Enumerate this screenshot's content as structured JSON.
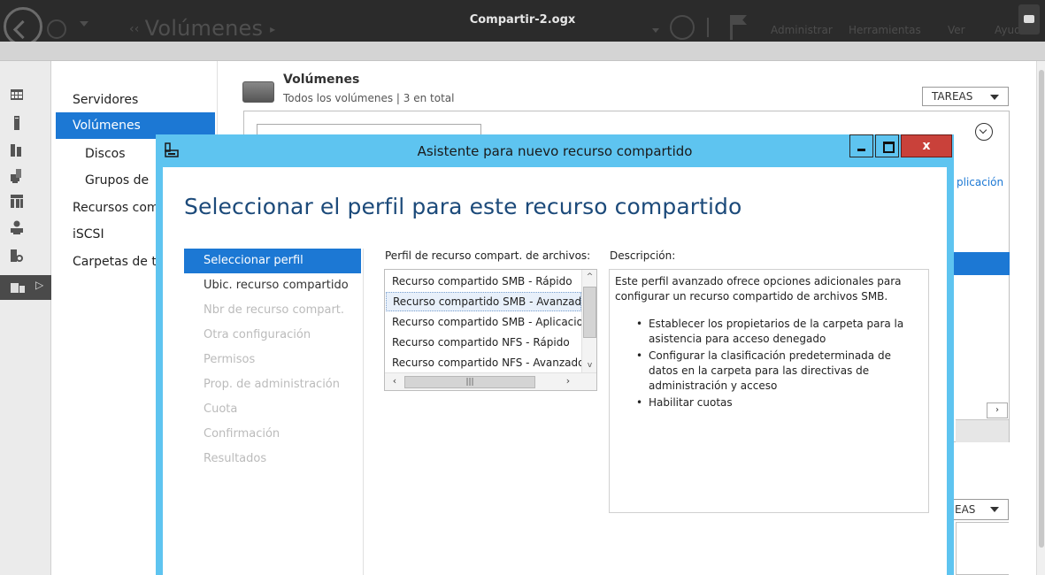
{
  "topbar": {
    "breadcrumb": "Volúmenes",
    "document_title": "Compartir-2.ogx",
    "menu": [
      "Administrar",
      "Herramientas",
      "Ver",
      "Ayuda"
    ]
  },
  "nav": {
    "items": [
      {
        "label": "Servidores"
      },
      {
        "label": "Volúmenes"
      },
      {
        "label": "Discos"
      },
      {
        "label": "Grupos de"
      },
      {
        "label": "Recursos com"
      },
      {
        "label": "iSCSI"
      },
      {
        "label": "Carpetas de t"
      }
    ]
  },
  "volumes": {
    "title": "Volúmenes",
    "subtitle": "Todos los volúmenes | 3 en total",
    "tasks_label": "TAREAS",
    "column_link": "plicación",
    "tasks_label_2": "EAS"
  },
  "wizard": {
    "window_title": "Asistente para nuevo recurso compartido",
    "heading": "Seleccionar el perfil para este recurso compartido",
    "steps": [
      {
        "label": "Seleccionar perfil"
      },
      {
        "label": "Ubic. recurso compartido"
      },
      {
        "label": "Nbr de recurso compart."
      },
      {
        "label": "Otra configuración"
      },
      {
        "label": "Permisos"
      },
      {
        "label": "Prop. de administración"
      },
      {
        "label": "Cuota"
      },
      {
        "label": "Confirmación"
      },
      {
        "label": "Resultados"
      }
    ],
    "profile_label": "Perfil de recurso compart. de archivos:",
    "profiles": [
      "Recurso compartido SMB - Rápido",
      "Recurso compartido SMB - Avanzado",
      "Recurso compartido SMB - Aplicaciones",
      "Recurso compartido NFS - Rápido",
      "Recurso compartido NFS - Avanzado"
    ],
    "selected_profile_index": 1,
    "description_label": "Descripción:",
    "description_intro": "Este perfil avanzado ofrece opciones adicionales para configurar un recurso compartido de archivos SMB.",
    "description_bullets": [
      "Establecer los propietarios de la carpeta para la asistencia para acceso denegado",
      "Configurar la clasificación predeterminada de datos en la carpeta para las directivas de administración y acceso",
      "Habilitar cuotas"
    ]
  },
  "colors": {
    "dialog_frame": "#5ec4f0",
    "selection": "#1c78d4",
    "close_button": "#c9413a",
    "heading": "#1c4a7a"
  },
  "icons": [
    "back-arrow-icon",
    "forward-arrow-icon",
    "refresh-icon",
    "flag-icon",
    "keyboard-icon",
    "volume-drive-icon",
    "wizard-app-icon"
  ]
}
